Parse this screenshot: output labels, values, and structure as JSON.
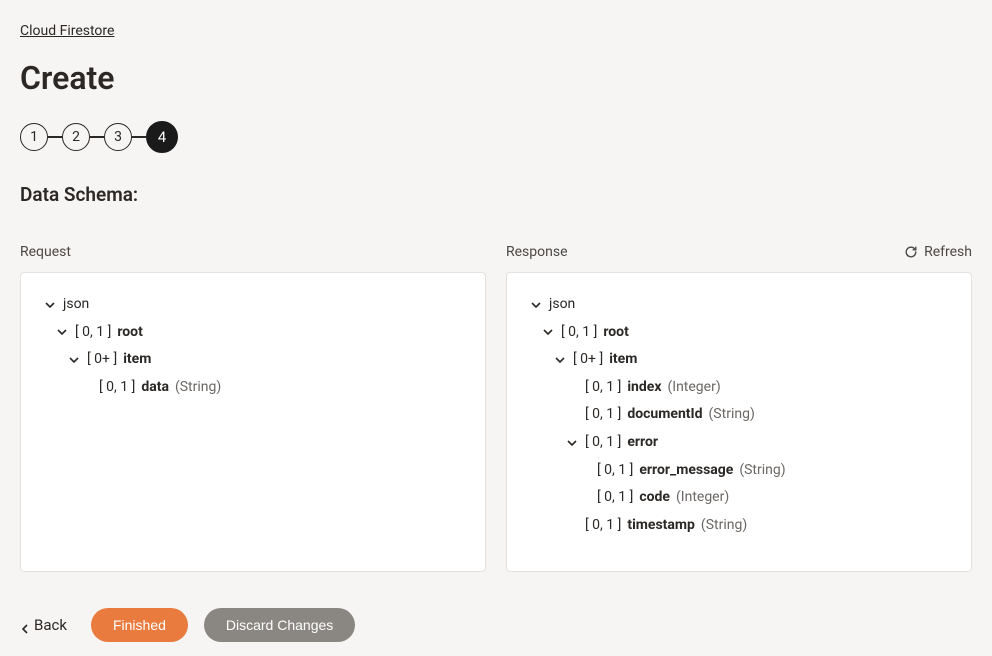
{
  "breadcrumb": "Cloud Firestore",
  "page_title": "Create",
  "stepper": {
    "steps": [
      "1",
      "2",
      "3",
      "4"
    ],
    "active_index": 3
  },
  "section_title": "Data Schema:",
  "refresh_label": "Refresh",
  "panels": {
    "request": {
      "label": "Request"
    },
    "response": {
      "label": "Response"
    }
  },
  "request_tree": {
    "root_label": "json",
    "nodes": {
      "root": {
        "card": "[ 0, 1 ]",
        "name": "root"
      },
      "item": {
        "card": "[ 0+ ]",
        "name": "item"
      },
      "data": {
        "card": "[ 0, 1 ]",
        "name": "data",
        "type": "(String)"
      }
    }
  },
  "response_tree": {
    "root_label": "json",
    "nodes": {
      "root": {
        "card": "[ 0, 1 ]",
        "name": "root"
      },
      "item": {
        "card": "[ 0+ ]",
        "name": "item"
      },
      "index": {
        "card": "[ 0, 1 ]",
        "name": "index",
        "type": "(Integer)"
      },
      "documentId": {
        "card": "[ 0, 1 ]",
        "name": "documentId",
        "type": "(String)"
      },
      "error": {
        "card": "[ 0, 1 ]",
        "name": "error"
      },
      "error_message": {
        "card": "[ 0, 1 ]",
        "name": "error_message",
        "type": "(String)"
      },
      "code": {
        "card": "[ 0, 1 ]",
        "name": "code",
        "type": "(Integer)"
      },
      "timestamp": {
        "card": "[ 0, 1 ]",
        "name": "timestamp",
        "type": "(String)"
      }
    }
  },
  "footer": {
    "back": "Back",
    "finished": "Finished",
    "discard": "Discard Changes"
  }
}
